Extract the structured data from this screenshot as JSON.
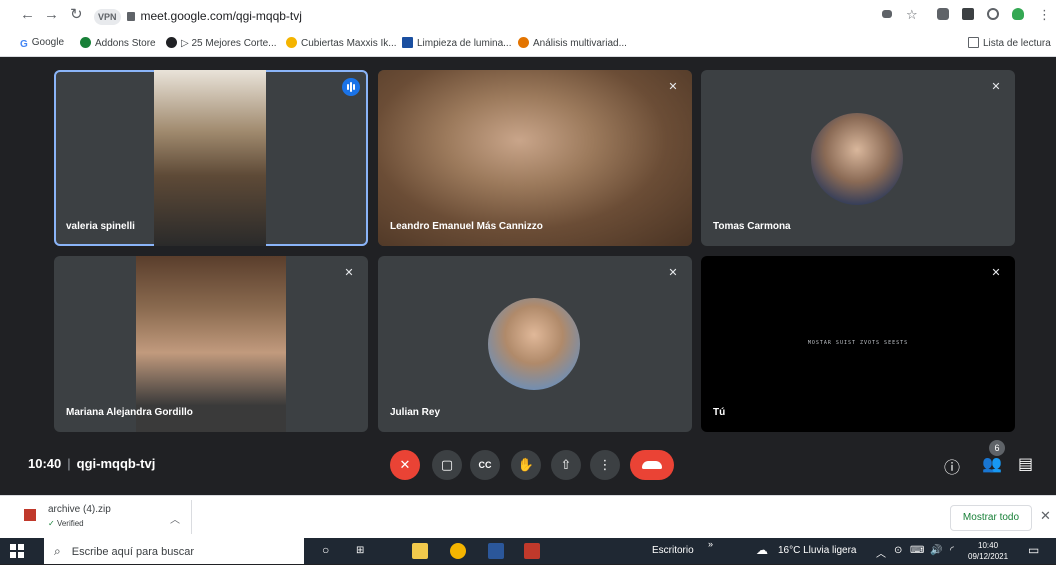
{
  "browser": {
    "url": "meet.google.com/qgi-mqqb-tvj",
    "vpn_label": "VPN",
    "bookmarks": [
      "Google",
      "Addons Store",
      "▷ 25 Mejores Corte...",
      "Cubiertas Maxxis Ik...",
      "Limpieza de lumina...",
      "Análisis multivariad..."
    ],
    "reading_list": "Lista de lectura"
  },
  "meet": {
    "participants": [
      {
        "name": "valeria spinelli",
        "speaking": true
      },
      {
        "name": "Leandro Emanuel Más Cannizzo",
        "muted": true
      },
      {
        "name": "Tomas Carmona",
        "muted": true
      },
      {
        "name": "Mariana Alejandra Gordillo",
        "muted": true
      },
      {
        "name": "Julian Rey",
        "muted": true
      },
      {
        "name": "Tú",
        "muted": true
      }
    ],
    "self_view_text": "MOSTAR SUIST ZVOTS SEESTS",
    "time": "10:40",
    "meeting_code": "qgi-mqqb-tvj",
    "participant_count": "6"
  },
  "downloads": {
    "file_name": "archive (4).zip",
    "status": "Verified",
    "show_all": "Mostrar todo"
  },
  "taskbar": {
    "search_placeholder": "Escribe aquí para buscar",
    "desktop_label": "Escritorio",
    "weather": "16°C  Lluvia ligera",
    "clock_time": "10:40",
    "clock_date": "09/12/2021"
  },
  "colors": {
    "meet_bg": "#202124",
    "tile_bg": "#3c4043",
    "accent": "#1a73e8",
    "danger": "#ea4335"
  }
}
